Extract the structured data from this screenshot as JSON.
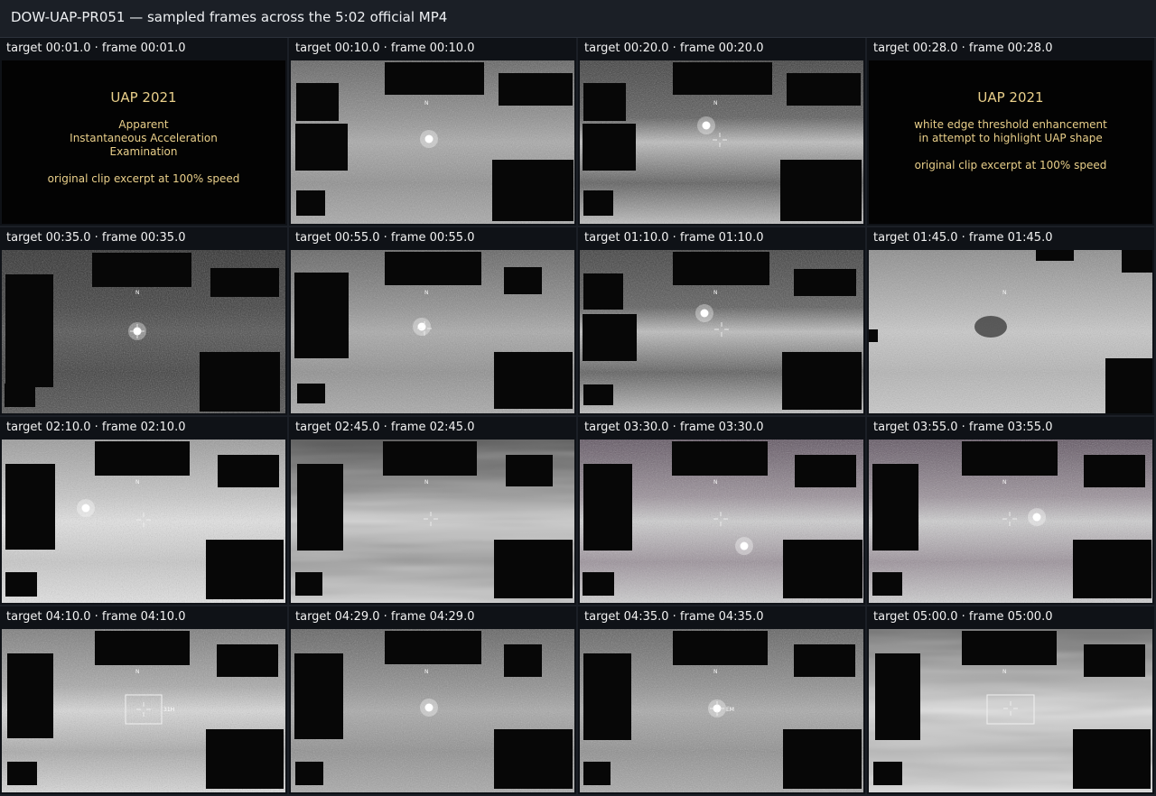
{
  "header": {
    "title": "DOW-UAP-PR051 — sampled frames across the 5:02 official MP4"
  },
  "colors": {
    "background": "#1b1f26",
    "caption_bg": "#0f1217",
    "title_text": "#e9cf8a",
    "redaction": "#070707"
  },
  "frames": [
    {
      "caption": "target 00:01.0 · frame 00:01.0",
      "kind": "title",
      "title": "UAP 2021",
      "lines": [
        "Apparent",
        "Instantaneous Acceleration",
        "Examination",
        "",
        "original clip excerpt at 100% speed"
      ]
    },
    {
      "caption": "target 00:10.0 · frame 00:10.0",
      "kind": "ir",
      "tone": "gray-noise"
    },
    {
      "caption": "target 00:20.0 · frame 00:20.0",
      "kind": "ir",
      "tone": "gray-cloud"
    },
    {
      "caption": "target 00:28.0 · frame 00:28.0",
      "kind": "title",
      "title": "UAP 2021",
      "lines": [
        "white edge threshold enhancement",
        "in attempt to highlight UAP shape",
        "",
        "original clip excerpt at 100% speed"
      ]
    },
    {
      "caption": "target 00:35.0 · frame 00:35.0",
      "kind": "ir",
      "tone": "dark"
    },
    {
      "caption": "target 00:55.0 · frame 00:55.0",
      "kind": "ir",
      "tone": "gray-noise"
    },
    {
      "caption": "target 01:10.0 · frame 01:10.0",
      "kind": "ir",
      "tone": "gray-cloud"
    },
    {
      "caption": "target 01:45.0 · frame 01:45.0",
      "kind": "ir",
      "tone": "light-zoom"
    },
    {
      "caption": "target 02:10.0 · frame 02:10.0",
      "kind": "ir",
      "tone": "light"
    },
    {
      "caption": "target 02:45.0 · frame 02:45.0",
      "kind": "ir",
      "tone": "streak"
    },
    {
      "caption": "target 03:30.0 · frame 03:30.0",
      "kind": "ir",
      "tone": "purple"
    },
    {
      "caption": "target 03:55.0 · frame 03:55.0",
      "kind": "ir",
      "tone": "purple"
    },
    {
      "caption": "target 04:10.0 · frame 04:10.0",
      "kind": "ir",
      "tone": "light-track",
      "overlay_text": "31H"
    },
    {
      "caption": "target 04:29.0 · frame 04:29.0",
      "kind": "ir",
      "tone": "gray-noise"
    },
    {
      "caption": "target 04:35.0 · frame 04:35.0",
      "kind": "ir",
      "tone": "gray-noise",
      "overlay_text": "EM"
    },
    {
      "caption": "target 05:00.0 · frame 05:00.0",
      "kind": "ir",
      "tone": "streak-light"
    }
  ]
}
